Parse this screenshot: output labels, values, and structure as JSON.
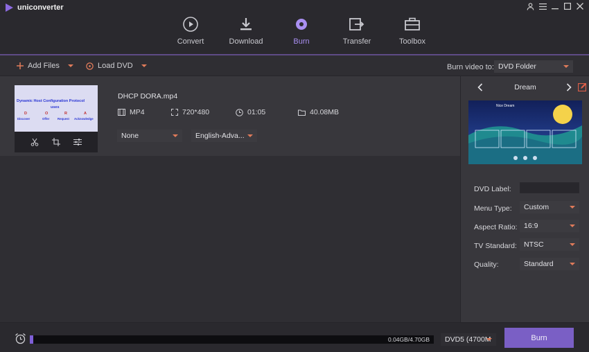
{
  "app": {
    "title": "uniconverter"
  },
  "window_controls": [
    "user-icon",
    "menu-icon",
    "minimize-icon",
    "maximize-icon",
    "close-icon"
  ],
  "nav": {
    "tabs": [
      {
        "label": "Convert",
        "icon": "convert-icon",
        "active": false
      },
      {
        "label": "Download",
        "icon": "download-icon",
        "active": false
      },
      {
        "label": "Burn",
        "icon": "burn-icon",
        "active": true
      },
      {
        "label": "Transfer",
        "icon": "transfer-icon",
        "active": false
      },
      {
        "label": "Toolbox",
        "icon": "toolbox-icon",
        "active": false
      }
    ]
  },
  "toolbar": {
    "add_files": "Add Files",
    "load_dvd": "Load DVD",
    "burn_to_label": "Burn video to:",
    "burn_to_value": "DVD Folder"
  },
  "file": {
    "name": "DHCP DORA.mp4",
    "format": "MP4",
    "resolution": "720*480",
    "duration": "01:05",
    "size": "40.08MB",
    "subtitle_select": "None",
    "audio_select": "English-Adva...",
    "thumb_lines": {
      "title": "Dynamic Host Configuration Protocol",
      "uses": "uses",
      "letters": [
        "D",
        "O",
        "R",
        "A"
      ],
      "words": [
        "Discover",
        "Offer",
        "Request",
        "Acknowledge"
      ]
    }
  },
  "panel": {
    "template_name": "Dream",
    "template_preview_text": "Nice Dream",
    "dvd_label": "DVD Label:",
    "dvd_label_value": "",
    "menu_type_label": "Menu Type:",
    "menu_type_value": "Custom",
    "aspect_ratio_label": "Aspect Ratio:",
    "aspect_ratio_value": "16:9",
    "tv_standard_label": "TV Standard:",
    "tv_standard_value": "NTSC",
    "quality_label": "Quality:",
    "quality_value": "Standard"
  },
  "bottom": {
    "capacity_text": "0.04GB/4.70GB",
    "capacity_fraction": 0.0085,
    "disc_type": "DVD5 (4700M",
    "burn_label": "Burn"
  },
  "colors": {
    "accent": "#7a5fc5",
    "active_tab": "#a98ff2",
    "caret": "#e07b5a"
  }
}
